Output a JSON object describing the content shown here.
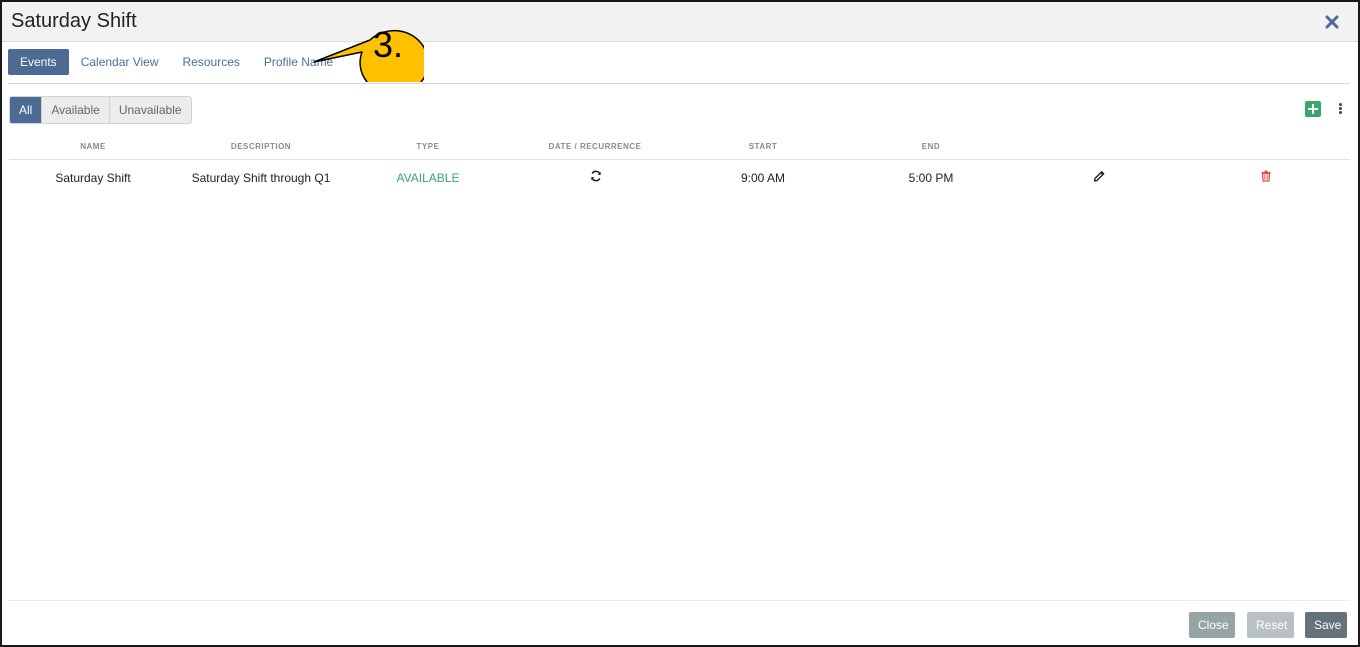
{
  "dialog": {
    "title": "Saturday Shift"
  },
  "tabs": [
    {
      "label": "Events",
      "active": true
    },
    {
      "label": "Calendar View",
      "active": false
    },
    {
      "label": "Resources",
      "active": false
    },
    {
      "label": "Profile Name",
      "active": false
    }
  ],
  "callout": {
    "label": "3.",
    "color": "#ffc000"
  },
  "filters": [
    {
      "label": "All",
      "active": true
    },
    {
      "label": "Available",
      "active": false
    },
    {
      "label": "Unavailable",
      "active": false
    }
  ],
  "table": {
    "columns": {
      "name": "NAME",
      "description": "DESCRIPTION",
      "type": "TYPE",
      "date_recurrence": "DATE / RECURRENCE",
      "start": "START",
      "end": "END"
    },
    "rows": [
      {
        "name": "Saturday Shift",
        "description": "Saturday Shift through Q1",
        "type": "AVAILABLE",
        "recurrence_icon": "recurrence-icon",
        "start": "9:00 AM",
        "end": "5:00 PM"
      }
    ]
  },
  "footer": {
    "close_label": "Close",
    "reset_label": "Reset",
    "save_label": "Save"
  },
  "colors": {
    "accent": "#4d6a94",
    "available": "#3aa76d",
    "delete": "#e04b4b"
  }
}
